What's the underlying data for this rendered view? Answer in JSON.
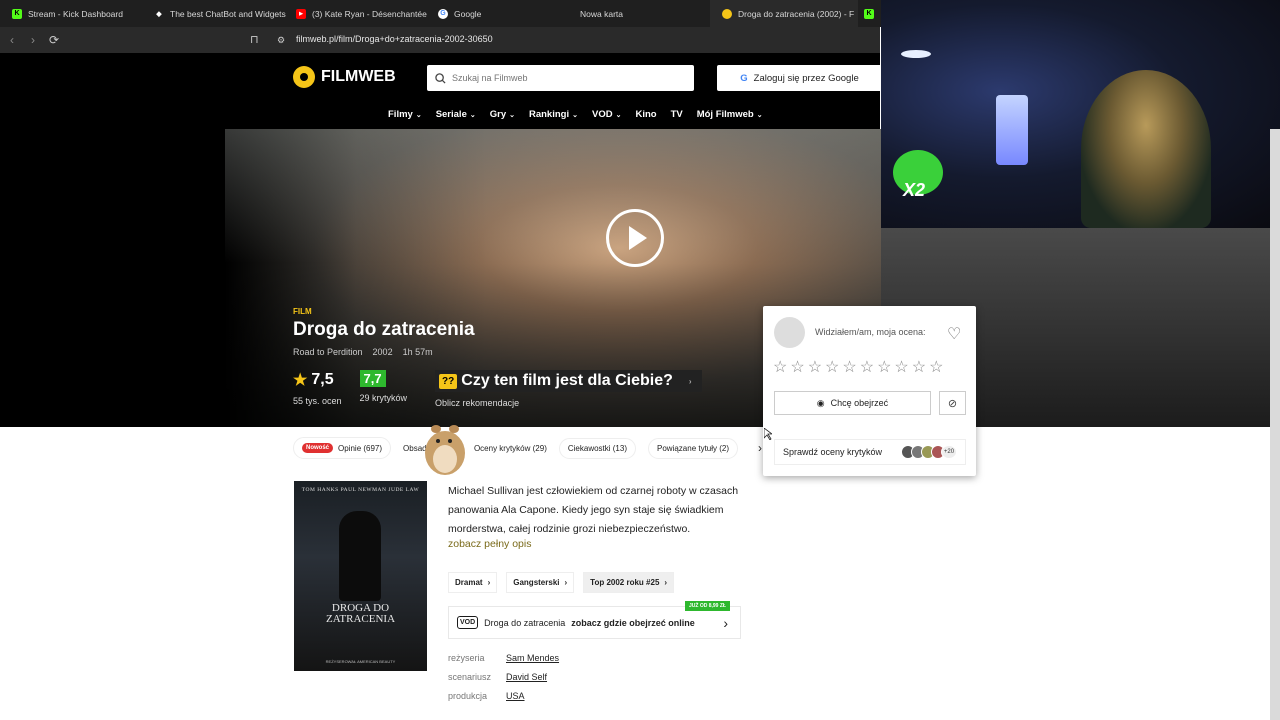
{
  "browser": {
    "tabs": [
      {
        "label": "Stream - Kick Dashboard",
        "favicon": "kick-icon",
        "color": "#53fc18"
      },
      {
        "label": "The best ChatBot and Widgets",
        "favicon": "diamond-icon",
        "color": "#ffffff"
      },
      {
        "label": "(3) Kate Ryan - Désenchantée",
        "favicon": "youtube-icon",
        "color": "#ff0000"
      },
      {
        "label": "Google",
        "favicon": "google-icon",
        "color": "#4285f4"
      },
      {
        "label": "Nowa karta",
        "favicon": "",
        "color": ""
      },
      {
        "label": "Droga do zatracenia (2002) - F",
        "favicon": "filmweb-icon",
        "color": "#f5c518"
      }
    ],
    "url": "filmweb.pl/film/Droga+do+zatracenia-2002-30650"
  },
  "header": {
    "logo": "FILMWEB",
    "search_placeholder": "Szukaj na Filmweb",
    "google_login": "Zaloguj się przez Google",
    "nav": [
      "Filmy",
      "Seriale",
      "Gry",
      "Rankingi",
      "VOD",
      "Kino",
      "TV",
      "Mój Filmweb"
    ]
  },
  "hero": {
    "kind": "FILM",
    "title": "Droga do zatracenia",
    "original_title": "Road to Perdition",
    "year": "2002",
    "duration": "1h 57m",
    "user_rating": "7,5",
    "user_votes": "55 tys. ocen",
    "critics_rating": "7,7",
    "critics_votes": "29 krytyków",
    "for_me_badge": "??",
    "for_me_label": "Czy ten film jest dla Ciebie?",
    "for_me_sub": "Oblicz rekomendacje"
  },
  "rate_card": {
    "seen_label": "Widziałem/am, moja ocena:",
    "want_label": "Chcę obejrzeć",
    "critics_check": "Sprawdź oceny krytyków",
    "critics_more": "+20",
    "stars_count": 10
  },
  "webcam": {
    "overlay_text": "X2"
  },
  "subtabs": {
    "new_badge": "Nowość",
    "items": [
      "Opinie (697)",
      "Obsada (",
      "Oceny krytyków (29)",
      "Ciekawostki (13)",
      "Powiązane tytuły (2)"
    ]
  },
  "poster": {
    "cast": "TOM HANKS    PAUL NEWMAN    JUDE LAW",
    "title_line1": "DROGA DO",
    "title_line2": "ZATRACENIA",
    "footer": "REŻYSEROWAŁ AMERICAN BEAUTY"
  },
  "details": {
    "description": "Michael Sullivan jest człowiekiem od czarnej roboty w czasach panowania Ala Capone. Kiedy jego syn staje się świadkiem morderstwa, całej rodzinie grozi niebezpieczeństwo.",
    "more_link": "zobacz pełny opis",
    "genres": [
      "Dramat",
      "Gangsterski",
      "Top 2002 roku #25"
    ],
    "vod_logo": "VOD",
    "vod_title": "Droga do zatracenia",
    "vod_link": "zobacz gdzie obejrzeć online",
    "vod_badge": "JUŻ OD 8,99 ZŁ",
    "credits": [
      {
        "key": "reżyseria",
        "value": "Sam Mendes"
      },
      {
        "key": "scenariusz",
        "value": "David Self"
      },
      {
        "key": "produkcja",
        "value": "USA"
      }
    ]
  }
}
